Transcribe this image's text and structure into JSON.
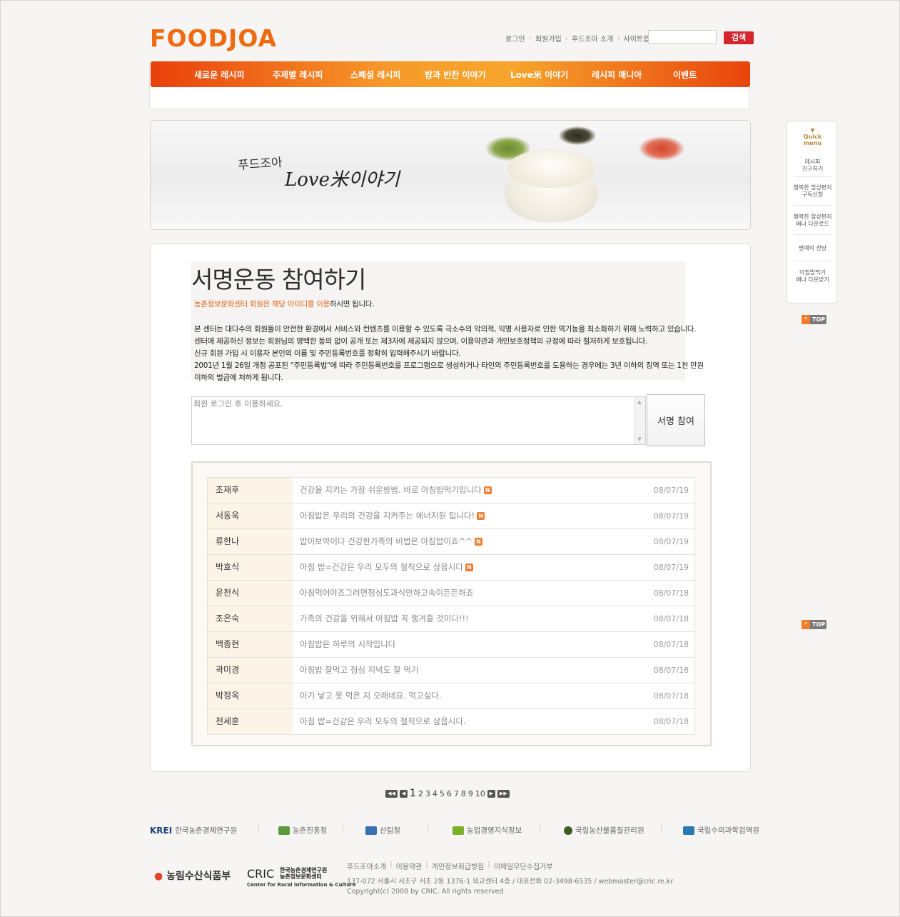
{
  "logo": "FOODJOA",
  "util_links": [
    "로그인",
    "회원가입",
    "푸드조아 소개",
    "사이트맵"
  ],
  "search": {
    "button": "검색",
    "placeholder": ""
  },
  "nav": [
    "새로운 레시피",
    "주제별 레시피",
    "스페셜 레시피",
    "밥과 반찬 이야기",
    "Love米 이야기",
    "레시피 매니아",
    "이벤트"
  ],
  "banner": {
    "line1": "푸드조아",
    "line2": "Love米이야기"
  },
  "page_title": "서명운동 참여하기",
  "notice": {
    "line1_orange": "농촌정보문화센터 회원은 해당 아이디를 이용",
    "line1_rest": "하시면 됩니다.",
    "line2": "본 센터는 대다수의 회원들이 안전한 환경에서 서비스와 컨텐츠를 이용할 수 있도록 극소수의 악의적, 익명 사용자로 인한 역기능을 최소화하기 위해  노력하고 있습니다.",
    "line3": "센터에 제공하신 정보는 회원님의 명백한 동의 없이 공개 또는 제3자에 제공되지 않으며, 이용약관과 개인보호정책의 규정에 따라  철저하게 보호됩니다.",
    "line4_orange": "신규 회원 가입 시 이용자 본인의 이름 및 주민등록번호를 정확히 입력해주시기 바랍니다.",
    "line5": "2001년 1월 26일 개정 공포된 \"주민등록법\"에 따라 주민등록번호를 프로그램으로 생성하거나 타인의 주민등록번호를 도용하는 경우에는 3년 이하의  징역 또는 1천 만원",
    "line6": "이하의 벌금에  처하게 됩니다."
  },
  "comment_box": {
    "placeholder": "회원 로그인 후 이용하세요."
  },
  "sign_button": "서명 참여",
  "entries": [
    {
      "name": "조재후",
      "message": "건강을 지키는 가장 쉬운방법. 바로 아침밥먹기입니다",
      "date": "08/07/19",
      "new": true
    },
    {
      "name": "서동욱",
      "message": "아침밥은 우리의 건강을 지켜주는 에너지원 입니다!",
      "date": "08/07/19",
      "new": true
    },
    {
      "name": "류한나",
      "message": "밥이보약이다 건강한가족의 비법은 아침밥이죠^^",
      "date": "08/07/19",
      "new": true
    },
    {
      "name": "박효식",
      "message": "아침 밥=건강은 우리 모두의 철칙으로 삼읍시다",
      "date": "08/07/19",
      "new": true
    },
    {
      "name": "윤천식",
      "message": "아침먹어야죠그러면점심도과식안하고속이든든하죠",
      "date": "08/07/18",
      "new": false
    },
    {
      "name": "조은숙",
      "message": "가족의 건강을 위해서 아침밥 꼭 챙겨줄 것이다!!!",
      "date": "08/07/18",
      "new": false
    },
    {
      "name": "백종현",
      "message": "아침밥은 하루의 시작입니다",
      "date": "08/07/18",
      "new": false
    },
    {
      "name": "곽미경",
      "message": "아침밥 잘먹고 점심 저녁도 잘 먹기",
      "date": "08/07/18",
      "new": false
    },
    {
      "name": "박정옥",
      "message": "아기 낳고 못 먹은 지 오래네요. 먹고싶다.",
      "date": "08/07/18",
      "new": false
    },
    {
      "name": "천세훈",
      "message": "아침 밥=건강은 우리 모두의 철칙으로 삼읍시다.",
      "date": "08/07/18",
      "new": false
    }
  ],
  "new_badge": "N",
  "pagination": {
    "pages": [
      "1",
      "2",
      "3",
      "4",
      "5",
      "6",
      "7",
      "8",
      "9",
      "10"
    ],
    "current": "1"
  },
  "quick_menu": {
    "header": [
      "Quick",
      "menu"
    ],
    "items": [
      [
        "레시피",
        "친구하기"
      ],
      [
        "행복한 밥상편지",
        "구독신청"
      ],
      [
        "행복한 밥상편지",
        "배너 다운로드"
      ],
      [
        "명예의 전당"
      ],
      [
        "아침밥먹기",
        "배너 다운받기"
      ]
    ]
  },
  "top_label": "TOP",
  "partners": [
    "한국농촌경제연구원",
    "농촌진흥청",
    "산림청",
    "농업경영지식정보",
    "국립농산물품질관리원",
    "국립수의과학검역원"
  ],
  "partner_logos": [
    "KREI"
  ],
  "footer": {
    "ministry": "농림수산식품부",
    "cric": "CRIC",
    "cric_sub": [
      "한국농촌경제연구원",
      "농촌정보문화센터"
    ],
    "cric_en": "Center for Rural Information & Culture",
    "links": [
      "푸드조아소개",
      "이용약관",
      "개인정보취급방침",
      "이메일무단수집거부"
    ],
    "address": "137-072 서울시 서초구 서초 2동 1376-1 외교센터 4층 / 대표전화 02-3498-6535 / webmaster@cric.re.kr",
    "copyright": "Copyright(c) 2008 by CRIC. All rights reserved"
  },
  "colors": {
    "brand": "#f06a12",
    "search_button": "#d4262c",
    "name_cell": "#fbf4e7"
  }
}
